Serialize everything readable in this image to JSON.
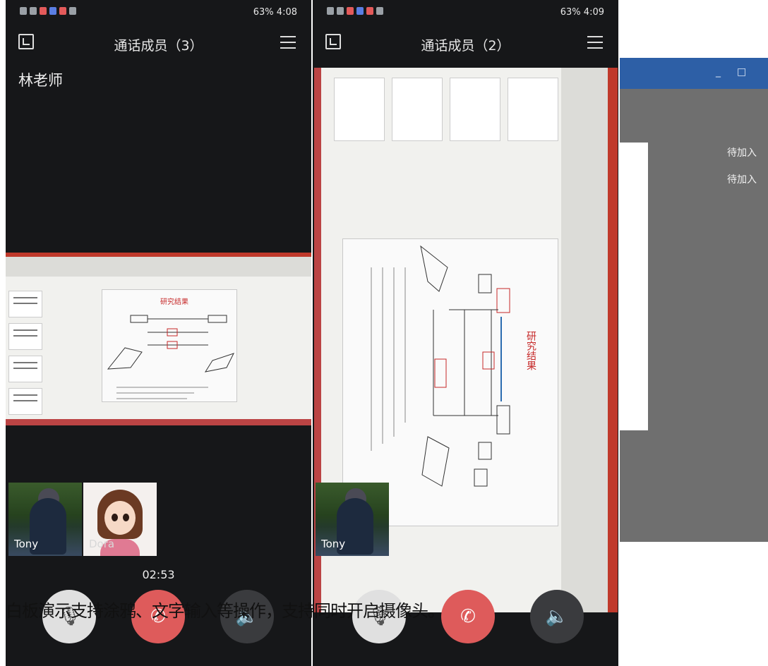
{
  "left_phone": {
    "status_time": "4:08",
    "status_battery": "63%",
    "title": "通话成员（3）",
    "caller_name": "林老师",
    "slide_title": "研究结果",
    "tile_tony_label": "Tony",
    "tile_avatar_label": "Dora",
    "call_timer": "02:53"
  },
  "right_phone": {
    "status_time": "4:09",
    "status_battery": "63%",
    "title": "通话成员（2）",
    "slide_title": "研究结果",
    "tile_tony_label": "Tony"
  },
  "desktop_window": {
    "pending_1": "待加入",
    "pending_2": "待加入",
    "minimize_glyph": "_",
    "maximize_glyph": "□"
  },
  "icons": {
    "mic": "microphone-muted-icon",
    "hangup": "hang-up-icon",
    "speaker": "speaker-icon",
    "minimize": "minimize-window-icon",
    "menu": "menu-icon"
  },
  "caption": "白板演示支持涂鸦、文字输入等操作，支持同时开启摄像头。"
}
